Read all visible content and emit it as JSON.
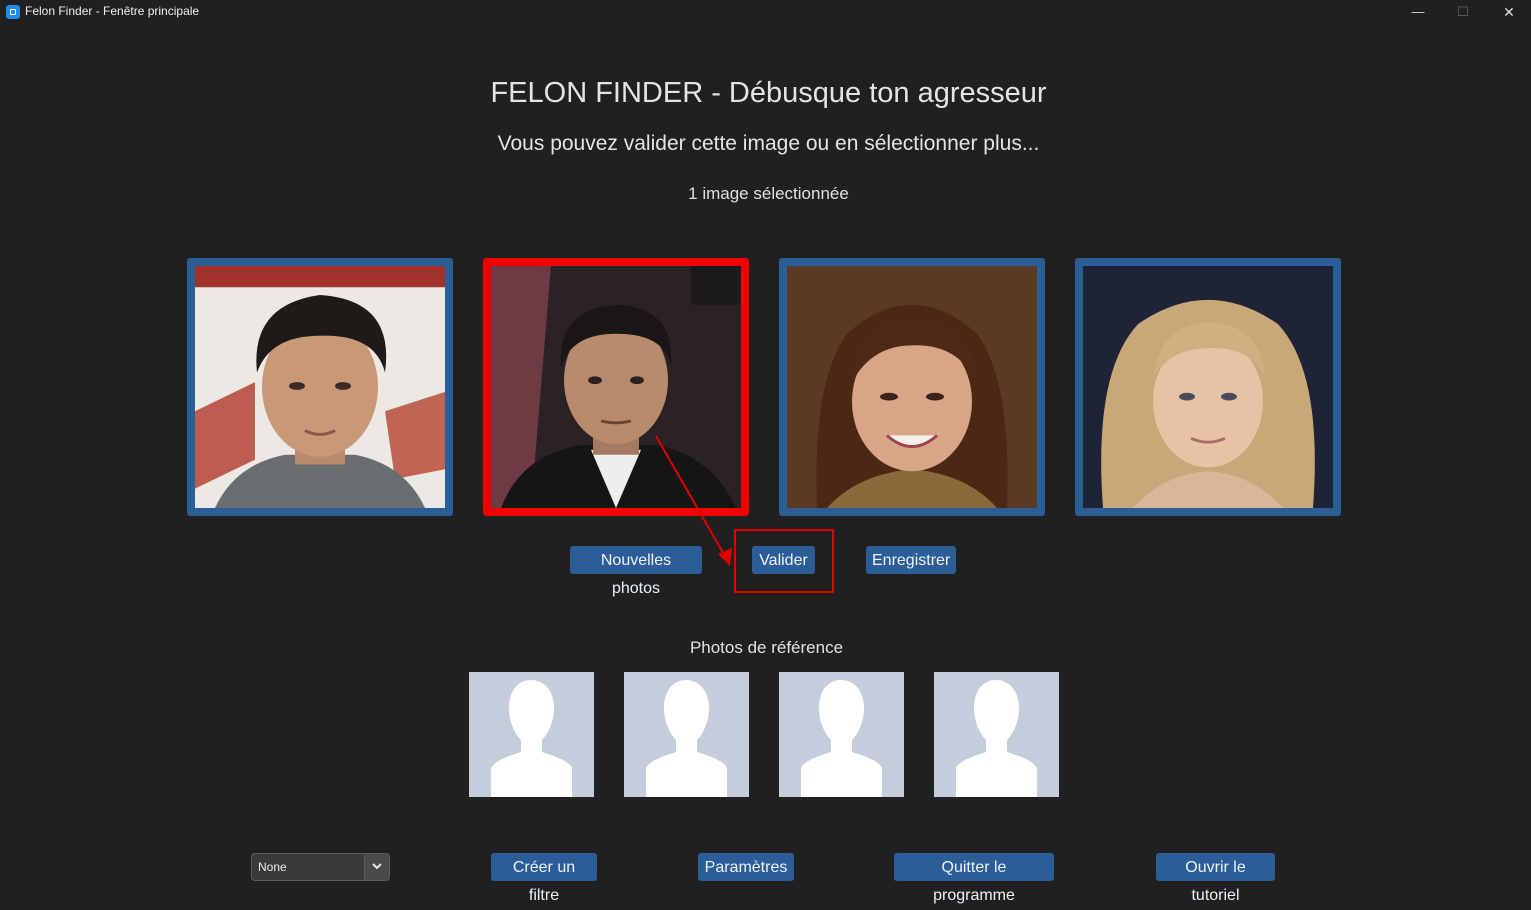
{
  "window": {
    "title": "Felon Finder - Fenêtre principale",
    "minimize_glyph": "—",
    "maximize_glyph": "☐",
    "close_glyph": "✕",
    "icon": "app-icon"
  },
  "header": {
    "title": "FELON FINDER - Débusque ton agresseur",
    "subtitle": "Vous pouvez valider cette image ou en sélectionner plus...",
    "selection_count": "1 image sélectionnée"
  },
  "candidates": [
    {
      "selected": false
    },
    {
      "selected": true
    },
    {
      "selected": false
    },
    {
      "selected": false
    }
  ],
  "actions": {
    "new_photos": "Nouvelles photos",
    "validate": "Valider",
    "save": "Enregistrer"
  },
  "reference": {
    "title": "Photos de référence",
    "slots": 4,
    "placeholder_icon": "person-silhouette-icon"
  },
  "footer": {
    "filter_select_value": "None",
    "create_filter": "Créer un filtre",
    "settings": "Paramètres",
    "quit": "Quitter le programme",
    "tutorial": "Ouvrir le tutoriel"
  },
  "colors": {
    "background": "#202020",
    "button": "#2c5d96",
    "card_border": "#2b5d97",
    "selected_border": "#f00000",
    "annotation": "#e00000",
    "placeholder": "#c5cddd"
  }
}
